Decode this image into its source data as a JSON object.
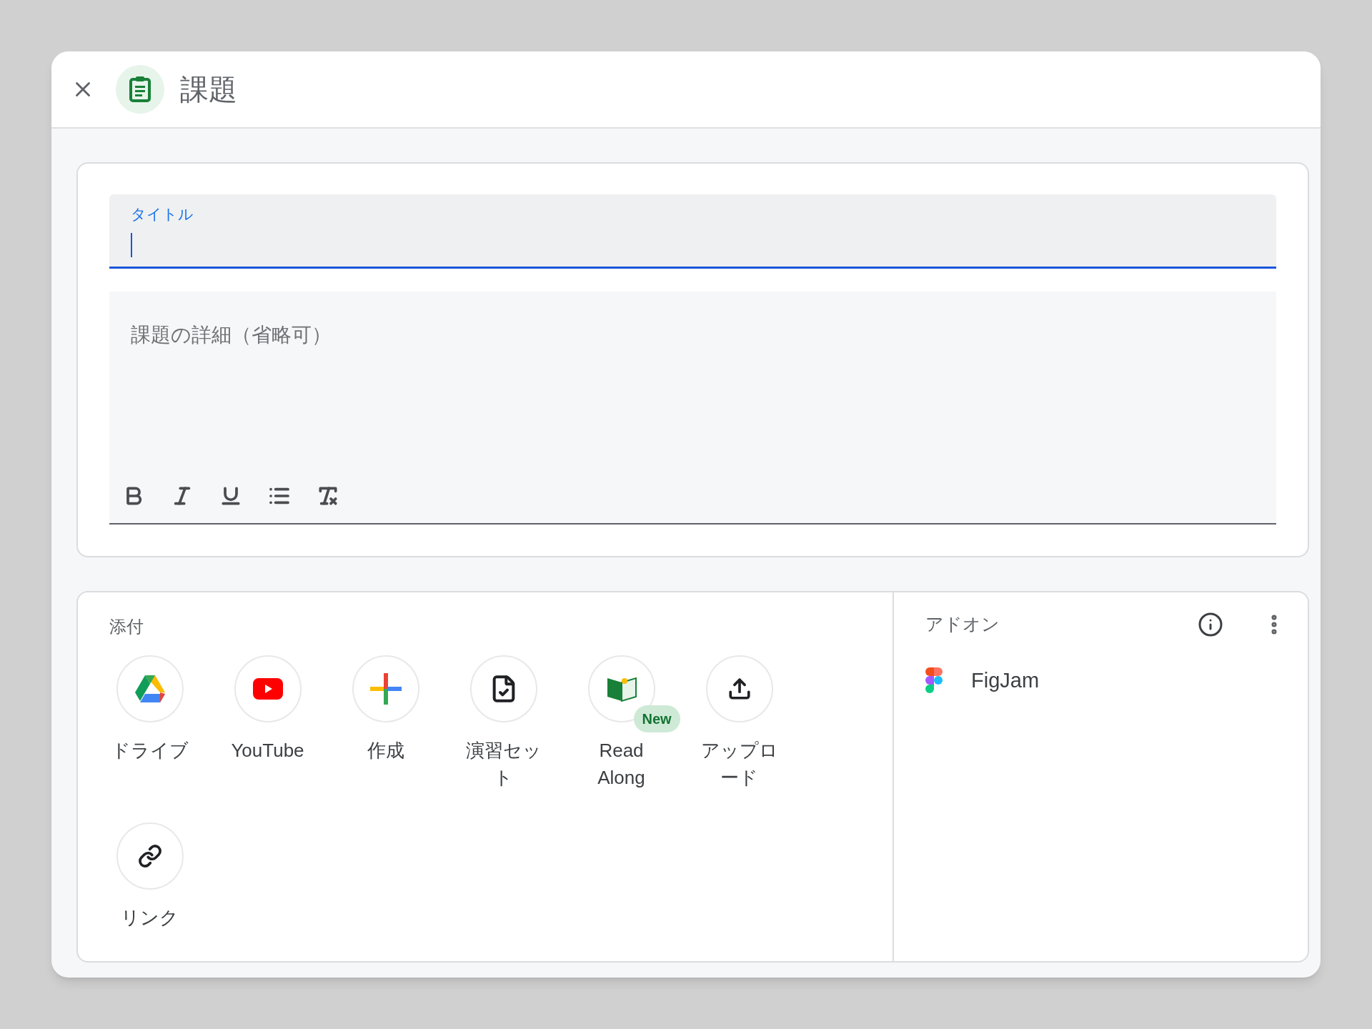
{
  "header": {
    "title": "課題"
  },
  "title_field": {
    "label": "タイトル",
    "focused": true
  },
  "description_field": {
    "placeholder": "課題の詳細（省略可）"
  },
  "attachments": {
    "heading": "添付",
    "items": [
      {
        "kind": "drive",
        "label": "ドライブ"
      },
      {
        "kind": "youtube",
        "label": "YouTube"
      },
      {
        "kind": "create",
        "label": "作成"
      },
      {
        "kind": "practice",
        "label": "演習セット"
      },
      {
        "kind": "readalong",
        "label": "Read Along",
        "badge": "New"
      },
      {
        "kind": "upload",
        "label": "アップロード"
      },
      {
        "kind": "link",
        "label": "リンク"
      }
    ]
  },
  "addons": {
    "heading": "アドオン",
    "items": [
      {
        "kind": "figma",
        "name": "FigJam"
      }
    ]
  }
}
